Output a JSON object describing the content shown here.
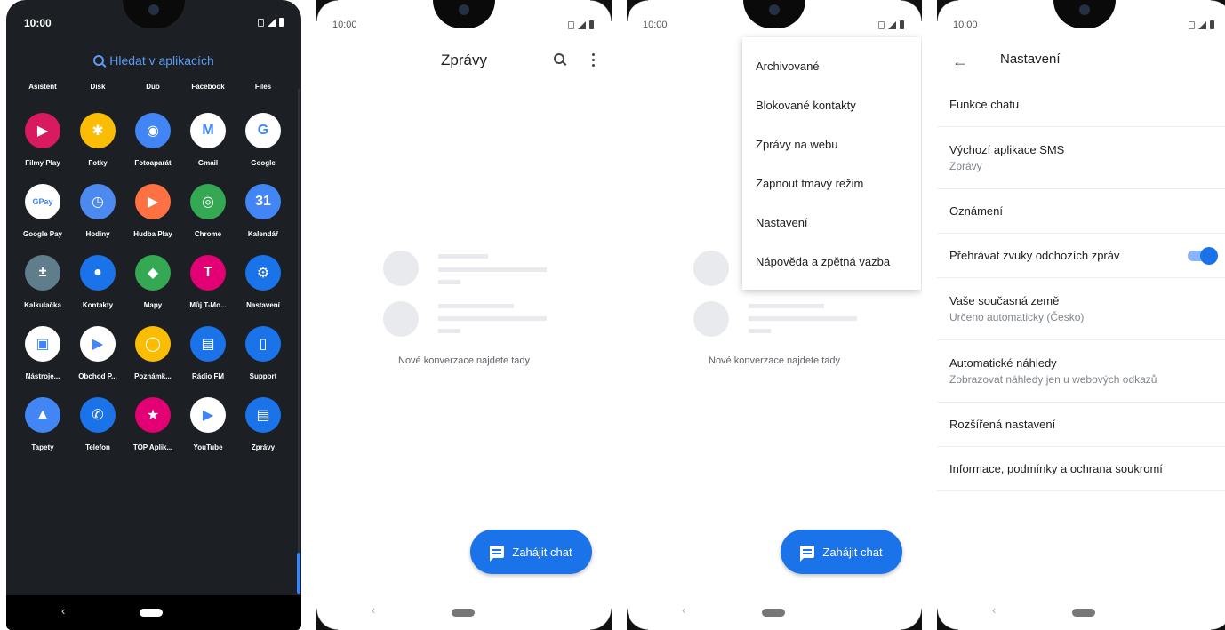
{
  "status": {
    "time": "10:00"
  },
  "drawer": {
    "search_label": "Hledat v aplikacích",
    "top_labels": [
      "Asistent",
      "Disk",
      "Duo",
      "Facebook",
      "Files"
    ],
    "apps": [
      {
        "label": "Filmy Play",
        "icon": "play-movies-icon",
        "color": "#d81b60",
        "glyph": "▶"
      },
      {
        "label": "Fotky",
        "icon": "photos-icon",
        "color": "#fbbc04",
        "glyph": "✱"
      },
      {
        "label": "Fotoaparát",
        "icon": "camera-icon",
        "color": "#4285f4",
        "glyph": "◉"
      },
      {
        "label": "Gmail",
        "icon": "gmail-icon",
        "color": "#ffffff",
        "glyph": "M"
      },
      {
        "label": "Google",
        "icon": "google-icon",
        "color": "#ffffff",
        "glyph": "G"
      },
      {
        "label": "Google Pay",
        "icon": "google-pay-icon",
        "color": "#ffffff",
        "glyph": "GPay"
      },
      {
        "label": "Hodiny",
        "icon": "clock-icon",
        "color": "#4d8af0",
        "glyph": "◷"
      },
      {
        "label": "Hudba Play",
        "icon": "play-music-icon",
        "color": "#ff7043",
        "glyph": "▶"
      },
      {
        "label": "Chrome",
        "icon": "chrome-icon",
        "color": "#34a853",
        "glyph": "◎"
      },
      {
        "label": "Kalendář",
        "icon": "calendar-icon",
        "color": "#4285f4",
        "glyph": "31"
      },
      {
        "label": "Kalkulačka",
        "icon": "calculator-icon",
        "color": "#607d8b",
        "glyph": "±"
      },
      {
        "label": "Kontakty",
        "icon": "contacts-icon",
        "color": "#1a73e8",
        "glyph": "●"
      },
      {
        "label": "Mapy",
        "icon": "maps-icon",
        "color": "#34a853",
        "glyph": "◆"
      },
      {
        "label": "Můj T-Mo...",
        "icon": "t-mobile-icon",
        "color": "#e20074",
        "glyph": "T"
      },
      {
        "label": "Nastavení",
        "icon": "settings-icon",
        "color": "#1a73e8",
        "glyph": "⚙"
      },
      {
        "label": "Nástroje...",
        "icon": "sim-toolkit-icon",
        "color": "#ffffff",
        "glyph": "▣"
      },
      {
        "label": "Obchod P...",
        "icon": "play-store-icon",
        "color": "#ffffff",
        "glyph": "▶"
      },
      {
        "label": "Poznámk...",
        "icon": "keep-icon",
        "color": "#fbbc04",
        "glyph": "◯"
      },
      {
        "label": "Rádio FM",
        "icon": "radio-icon",
        "color": "#1a73e8",
        "glyph": "▤"
      },
      {
        "label": "Support",
        "icon": "support-icon",
        "color": "#1a73e8",
        "glyph": "▯"
      },
      {
        "label": "Tapety",
        "icon": "wallpapers-icon",
        "color": "#4285f4",
        "glyph": "▲"
      },
      {
        "label": "Telefon",
        "icon": "phone-icon",
        "color": "#1a73e8",
        "glyph": "✆"
      },
      {
        "label": "TOP Aplik...",
        "icon": "top-apps-icon",
        "color": "#e20074",
        "glyph": "★"
      },
      {
        "label": "YouTube",
        "icon": "youtube-icon",
        "color": "#ffffff",
        "glyph": "▶"
      },
      {
        "label": "Zprávy",
        "icon": "messages-icon",
        "color": "#1a73e8",
        "glyph": "▤"
      },
      {
        "label": "Zprávy",
        "icon": "messages-icon",
        "color": "#1a73e8",
        "glyph": "▤"
      }
    ]
  },
  "messages": {
    "title": "Zprávy",
    "empty_text": "Nové konverzace najdete tady",
    "fab_label": "Zahájit chat"
  },
  "menu": {
    "items": [
      "Archivované",
      "Blokované kontakty",
      "Zprávy na webu",
      "Zapnout tmavý režim",
      "Nastavení",
      "Nápověda a zpětná vazba"
    ]
  },
  "settings": {
    "title": "Nastavení",
    "rows": [
      {
        "title": "Funkce chatu",
        "subtitle": ""
      },
      {
        "title": "Výchozí aplikace SMS",
        "subtitle": "Zprávy"
      },
      {
        "title": "Oznámení",
        "subtitle": ""
      },
      {
        "title": "Přehrávat zvuky odchozích zpráv",
        "subtitle": "",
        "toggle": true
      },
      {
        "title": "Vaše současná země",
        "subtitle": "Určeno automaticky (Česko)"
      },
      {
        "title": "Automatické náhledy",
        "subtitle": "Zobrazovat náhledy jen u webových odkazů"
      },
      {
        "title": "Rozšířená nastavení",
        "subtitle": ""
      },
      {
        "title": "Informace, podmínky a ochrana soukromí",
        "subtitle": ""
      }
    ]
  },
  "colors": {
    "accent": "#1a73e8",
    "drawer_bg": "#1c1f23",
    "search": "#5b9bf5"
  }
}
